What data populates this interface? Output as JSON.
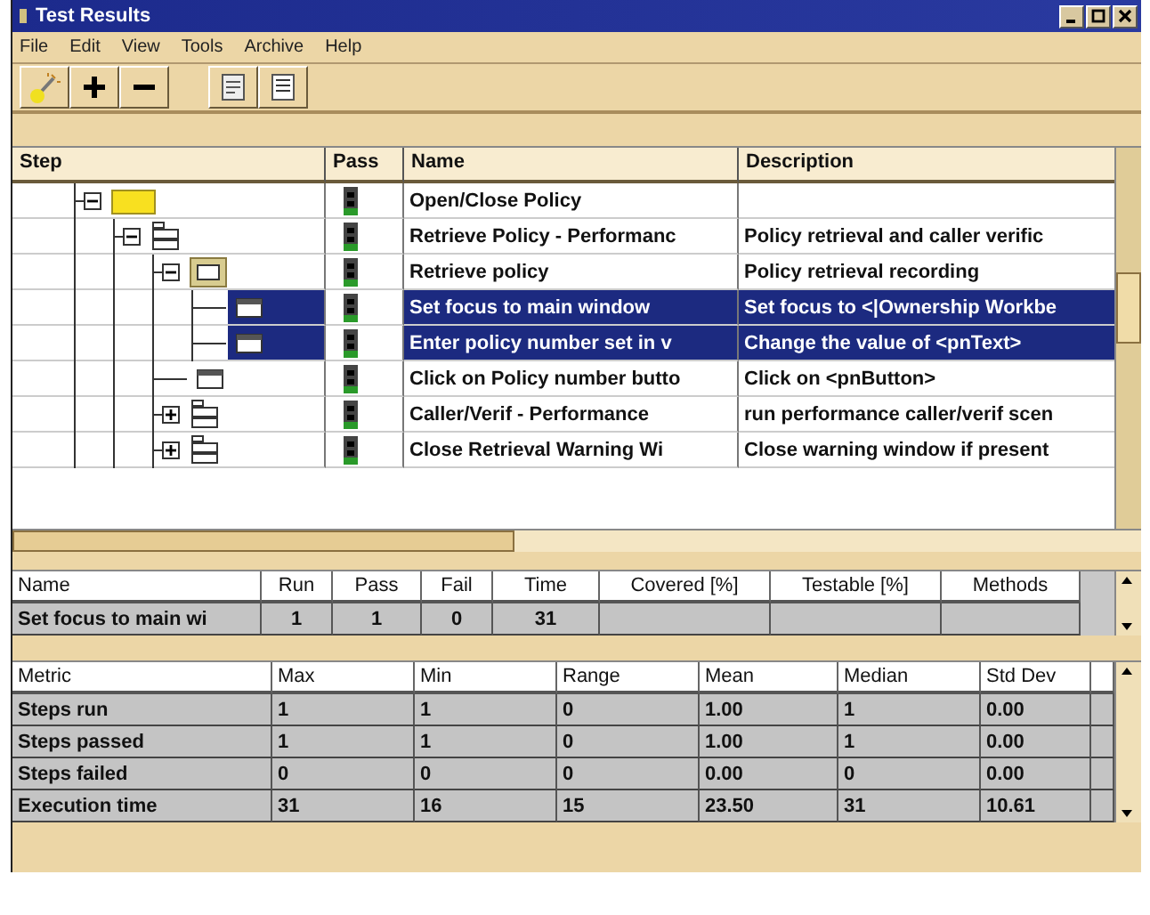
{
  "window": {
    "title": "Test Results"
  },
  "menu": [
    "File",
    "Edit",
    "View",
    "Tools",
    "Archive",
    "Help"
  ],
  "steps": {
    "columns": [
      "Step",
      "Pass",
      "Name",
      "Description"
    ],
    "rows": [
      {
        "kind": "folder",
        "expanded": true,
        "passed": true,
        "selected": false,
        "name": "Open/Close Policy",
        "children": [
          {
            "kind": "script",
            "expanded": true,
            "passed": true,
            "selected": false,
            "name": "Retrieve Policy - Performanc",
            "description": "Policy retrieval and caller verific",
            "children": [
              {
                "kind": "recording",
                "expanded": true,
                "passed": true,
                "selected": false,
                "name": "Retrieve policy",
                "description": "Policy retrieval recording",
                "children": [
                  {
                    "kind": "step",
                    "passed": true,
                    "selected": true,
                    "name": "Set focus to main window",
                    "description": "Set focus to <|Ownership Workbe"
                  },
                  {
                    "kind": "step",
                    "passed": true,
                    "selected": true,
                    "name": "Enter policy number set in v",
                    "description": "Change the value of <pnText>"
                  }
                ]
              },
              {
                "kind": "step",
                "passed": true,
                "selected": false,
                "name": "Click on Policy number butto",
                "description": "Click on <pnButton>"
              },
              {
                "kind": "script",
                "expanded": false,
                "passed": true,
                "selected": false,
                "name": "Caller/Verif - Performance",
                "description": "run performance caller/verif scen"
              },
              {
                "kind": "script",
                "expanded": false,
                "passed": true,
                "selected": false,
                "name": "Close Retrieval Warning Wi",
                "description": "Close warning window if present"
              }
            ]
          }
        ]
      }
    ]
  },
  "summary": {
    "columns": [
      "Name",
      "Run",
      "Pass",
      "Fail",
      "Time",
      "Covered [%]",
      "Testable [%]",
      "Methods"
    ],
    "rows": [
      [
        "Set focus to main wi",
        "1",
        "1",
        "0",
        "31",
        "",
        "",
        ""
      ]
    ]
  },
  "metrics": {
    "columns": [
      "Metric",
      "Max",
      "Min",
      "Range",
      "Mean",
      "Median",
      "Std Dev"
    ],
    "rows": [
      [
        "Steps run",
        "1",
        "1",
        "0",
        "1.00",
        "1",
        "0.00"
      ],
      [
        "Steps passed",
        "1",
        "1",
        "0",
        "1.00",
        "1",
        "0.00"
      ],
      [
        "Steps failed",
        "0",
        "0",
        "0",
        "0.00",
        "0",
        "0.00"
      ],
      [
        "Execution time",
        "31",
        "16",
        "15",
        "23.50",
        "31",
        "10.61"
      ]
    ]
  }
}
